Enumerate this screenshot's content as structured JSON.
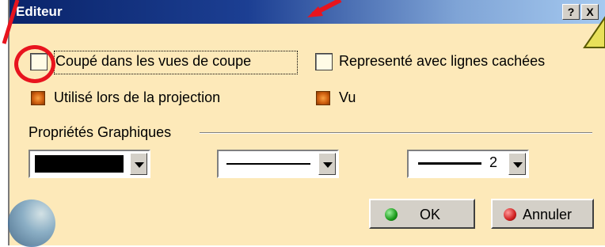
{
  "window": {
    "title": "Editeur",
    "help_label": "?",
    "close_label": "X"
  },
  "options": {
    "cut_in_section_views": {
      "label": "Coupé dans les vues de coupe",
      "checked": false
    },
    "hidden_lines": {
      "label": "Representé avec lignes cachées",
      "checked": false
    },
    "used_in_projection": {
      "label": "Utilisé lors de la projection",
      "checked": true
    },
    "seen": {
      "label": "Vu",
      "checked": true
    }
  },
  "graphic_properties": {
    "label": "Propriétés Graphiques",
    "color_value": "black",
    "linetype_value": "solid",
    "thickness_value": "2"
  },
  "buttons": {
    "ok_label": "OK",
    "cancel_label": "Annuler"
  },
  "colors": {
    "dialog_bg": "#fde9b9",
    "title_start": "#0a246a",
    "title_end": "#a6caf0",
    "annotation_red": "#e8141e",
    "ok_green": "#1a9a1a",
    "cancel_red": "#d02020",
    "annotation_yellow": "#e8e05a"
  }
}
